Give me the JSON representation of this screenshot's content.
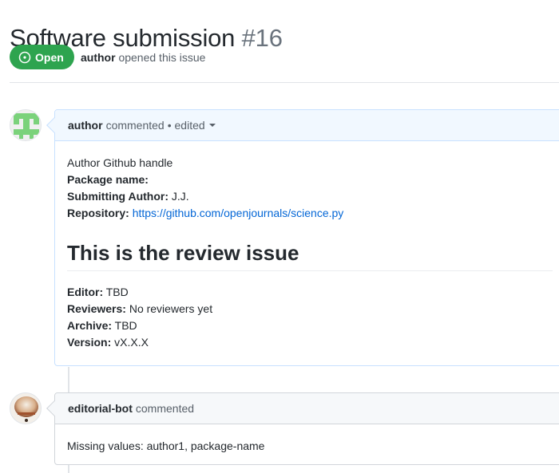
{
  "issue": {
    "title": "Software submission",
    "number": "#16",
    "state": "Open",
    "author": "author",
    "meta_text": "opened this issue"
  },
  "comments": [
    {
      "author": "author",
      "action": "commented",
      "edited": "• edited",
      "lines": [
        {
          "text": "Author Github handle"
        },
        {
          "label": "Package name:",
          "value": ""
        },
        {
          "label": "Submitting Author:",
          "value": " J.J."
        },
        {
          "label": "Repository:",
          "link": "https://github.com/openjournals/science.py"
        }
      ],
      "heading": "This is the review issue",
      "fields": [
        {
          "label": "Editor:",
          "value": " TBD"
        },
        {
          "label": "Reviewers:",
          "value": " No reviewers yet"
        },
        {
          "label": "Archive:",
          "value": " TBD"
        },
        {
          "label": "Version:",
          "value": " vX.X.X"
        }
      ]
    },
    {
      "author": "editorial-bot",
      "action": "commented",
      "body": "Missing values: author1, package-name"
    }
  ],
  "colors": {
    "open_badge": "#2ea44f",
    "link": "#0366d6",
    "header_blue": "#f1f8ff"
  }
}
